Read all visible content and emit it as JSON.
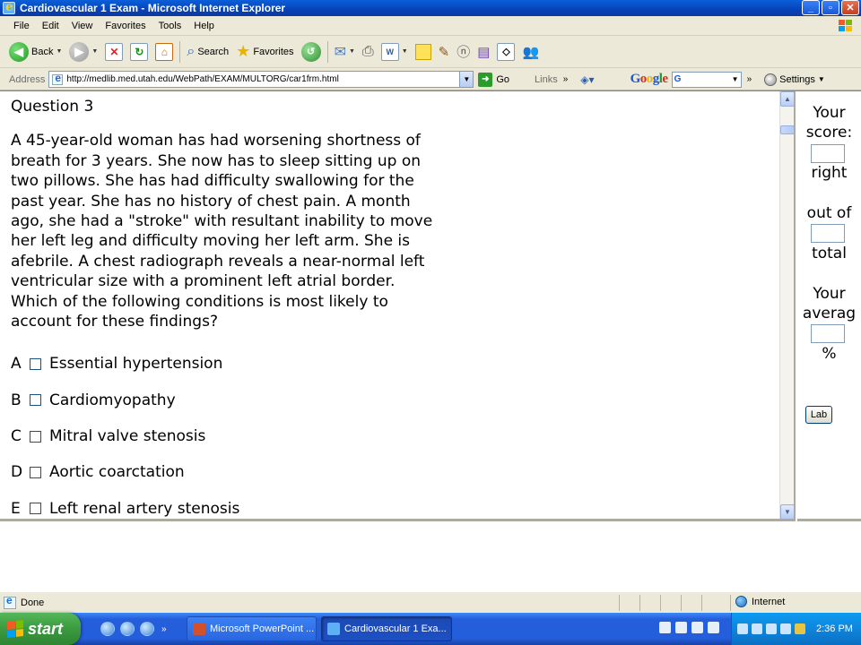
{
  "window": {
    "title": "Cardiovascular 1 Exam - Microsoft Internet Explorer"
  },
  "menu": [
    "File",
    "Edit",
    "View",
    "Favorites",
    "Tools",
    "Help"
  ],
  "toolbar": {
    "back_label": "Back",
    "search_label": "Search",
    "favorites_label": "Favorites"
  },
  "address": {
    "label": "Address",
    "url": "http://medlib.med.utah.edu/WebPath/EXAM/MULTORG/car1frm.html",
    "go_label": "Go",
    "links_label": "Links",
    "google_label": "Google",
    "google_search_value": "G",
    "settings_label": "Settings"
  },
  "question": {
    "heading": "Question 3",
    "body": "A 45-year-old woman has had worsening shortness of breath for 3 years. She now has to sleep sitting up on two pillows. She has had difficulty swallowing for the past year. She has no history of chest pain. A month ago, she had a \"stroke\" with resultant inability to move her left leg and difficulty moving her left arm. She is afebrile. A chest radiograph reveals a near-normal left ventricular size with a prominent left atrial border. Which of the following conditions is most likely to account for these findings?",
    "options": [
      {
        "letter": "A",
        "text": "Essential hypertension"
      },
      {
        "letter": "B",
        "text": "Cardiomyopathy"
      },
      {
        "letter": "C",
        "text": "Mitral valve stenosis"
      },
      {
        "letter": "D",
        "text": "Aortic coarctation"
      },
      {
        "letter": "E",
        "text": "Left renal artery stenosis"
      }
    ]
  },
  "score_panel": {
    "your_label": "Your",
    "score_label": "score:",
    "right_label": "right",
    "out_of_label": "out of",
    "total_label": "total",
    "your2_label": "Your",
    "average_label": "averag",
    "percent_label": "%",
    "lab_button": "Lab",
    "score_value": "",
    "total_value": "",
    "average_value": ""
  },
  "status": {
    "text": "Done",
    "zone": "Internet"
  },
  "taskbar": {
    "start_label": "start",
    "tasks": [
      "Microsoft PowerPoint ...",
      "Cardiovascular 1 Exa..."
    ],
    "clock": "2:36 PM"
  }
}
